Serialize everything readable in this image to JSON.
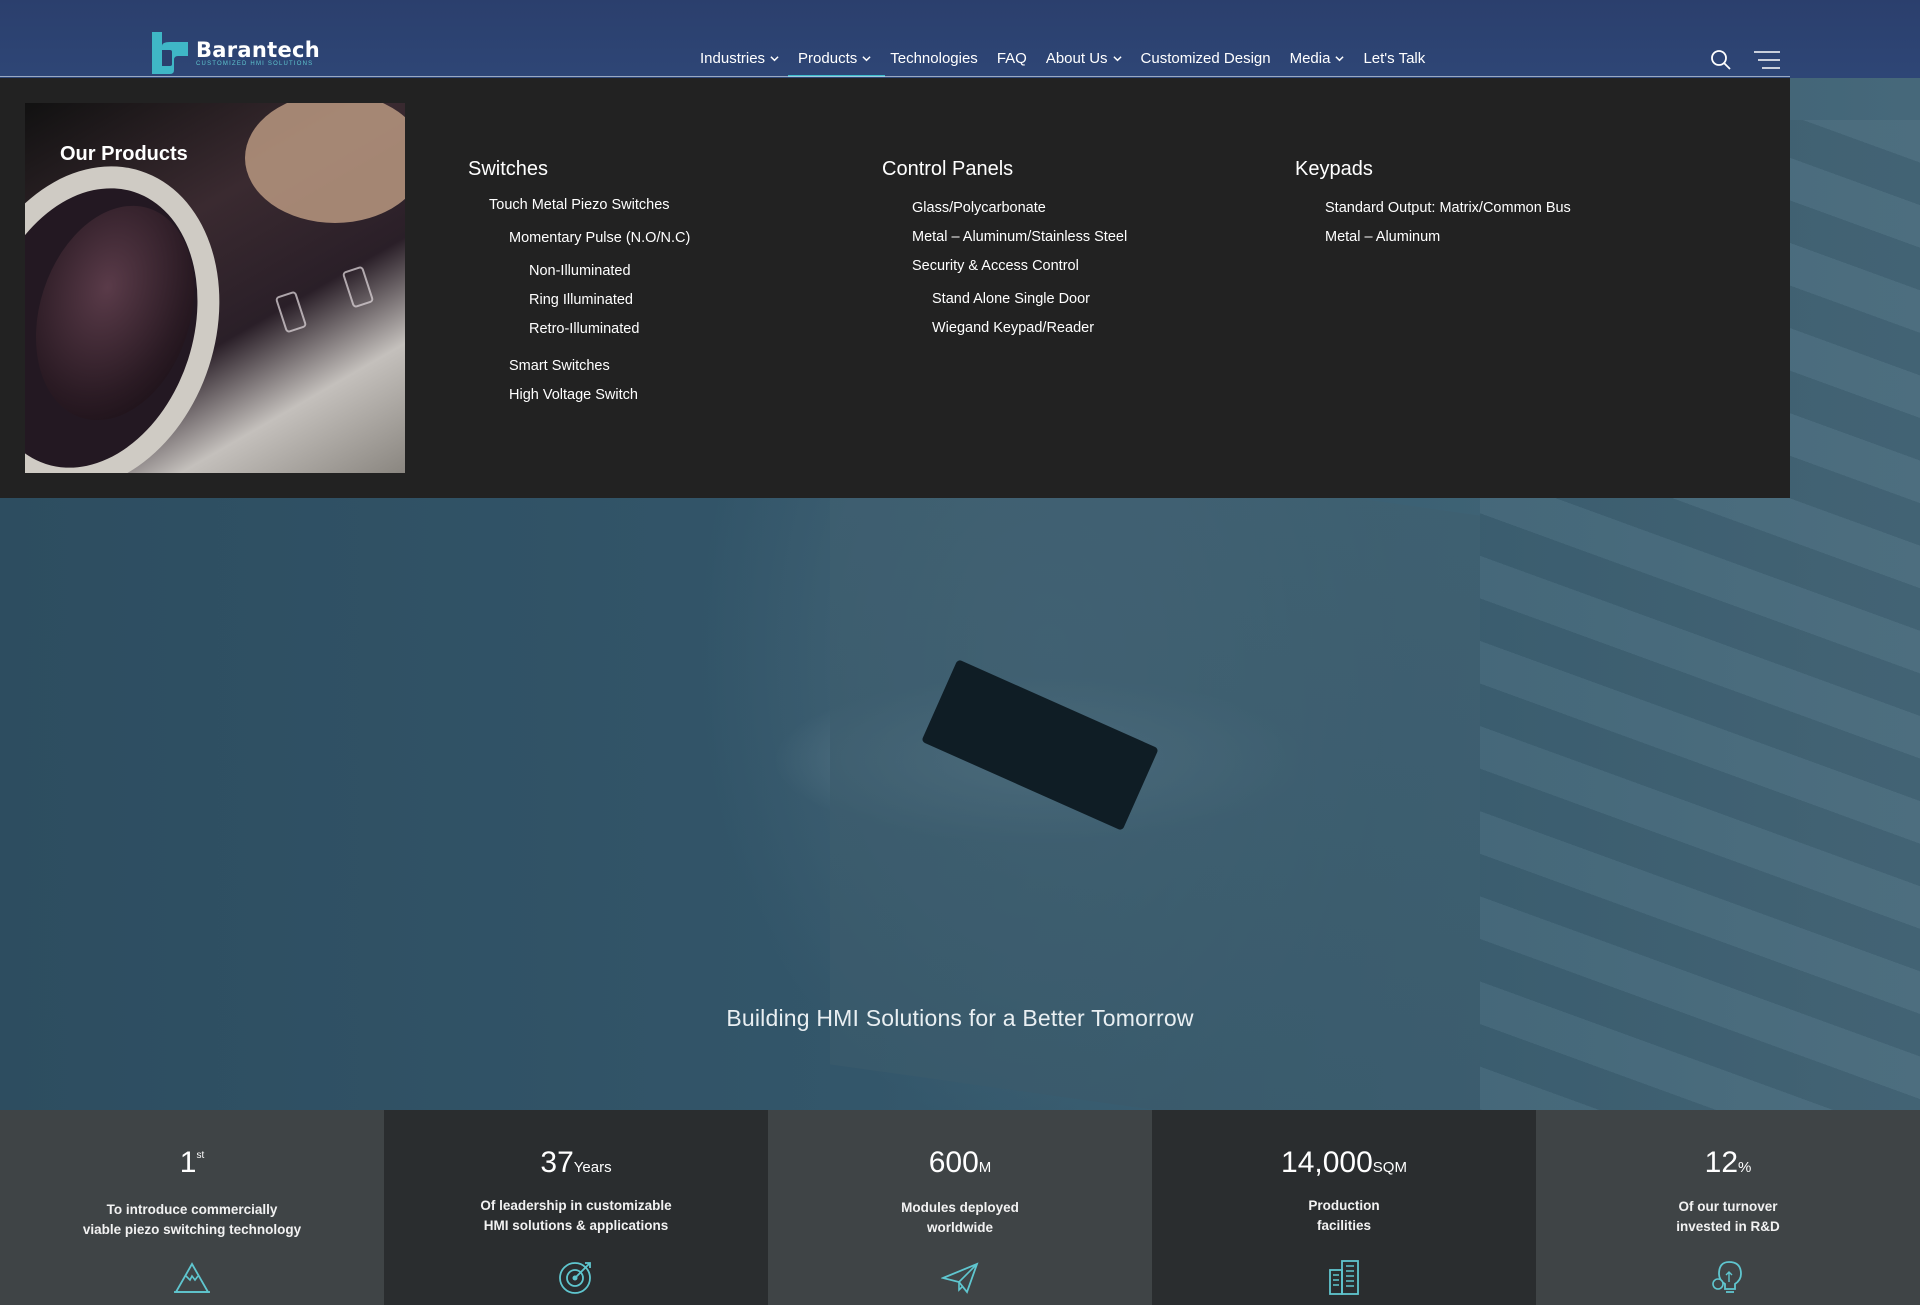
{
  "brand": {
    "name": "Barantech",
    "tagline": "CUSTOMIZED HMI SOLUTIONS",
    "accent_color": "#3dbccc"
  },
  "nav": {
    "items": [
      {
        "label": "Industries",
        "has_dropdown": true
      },
      {
        "label": "Products",
        "has_dropdown": true,
        "active": true
      },
      {
        "label": "Technologies",
        "has_dropdown": false
      },
      {
        "label": "FAQ",
        "has_dropdown": false
      },
      {
        "label": "About Us",
        "has_dropdown": true
      },
      {
        "label": "Customized Design",
        "has_dropdown": false
      },
      {
        "label": "Media",
        "has_dropdown": true
      },
      {
        "label": "Let's Talk",
        "has_dropdown": false
      }
    ],
    "search_icon": "search-icon",
    "menu_icon": "hamburger-menu-icon"
  },
  "mega_menu": {
    "title": "Our Products",
    "columns": [
      {
        "heading": "Switches",
        "links": [
          "Touch Metal Piezo Switches",
          "Momentary Pulse (N.O/N.C)",
          "Non-Illuminated",
          "Ring Illuminated",
          "Retro-Illuminated",
          "Smart Switches",
          "High Voltage Switch"
        ]
      },
      {
        "heading": "Control Panels",
        "links": [
          "Glass/Polycarbonate",
          "Metal – Aluminum/Stainless Steel",
          "Security & Access Control",
          "Stand Alone Single Door",
          "Wiegand Keypad/Reader"
        ]
      },
      {
        "heading": "Keypads",
        "links": [
          "Standard Output: Matrix/Common Bus",
          "Metal – Aluminum"
        ]
      }
    ]
  },
  "hero": {
    "tagline": "Building HMI Solutions for a Better Tomorrow"
  },
  "stats": [
    {
      "value": "1",
      "suffix": "st",
      "desc_line1": "To introduce commercially",
      "desc_line2": "viable piezo switching technology",
      "icon": "mountain-peak-icon"
    },
    {
      "value": "37",
      "suffix": "Years",
      "desc_line1": "Of leadership in customizable",
      "desc_line2": "HMI solutions & applications",
      "icon": "target-icon"
    },
    {
      "value": "600",
      "suffix": "M",
      "desc_line1": "Modules deployed",
      "desc_line2": "worldwide",
      "icon": "paper-plane-icon"
    },
    {
      "value": "14,000",
      "suffix": "SQM",
      "desc_line1": "Production",
      "desc_line2": "facilities",
      "icon": "building-icon"
    },
    {
      "value": "12",
      "suffix": "%",
      "desc_line1": "Of our turnover",
      "desc_line2": "invested in R&D",
      "icon": "lightbulb-gear-icon"
    }
  ]
}
